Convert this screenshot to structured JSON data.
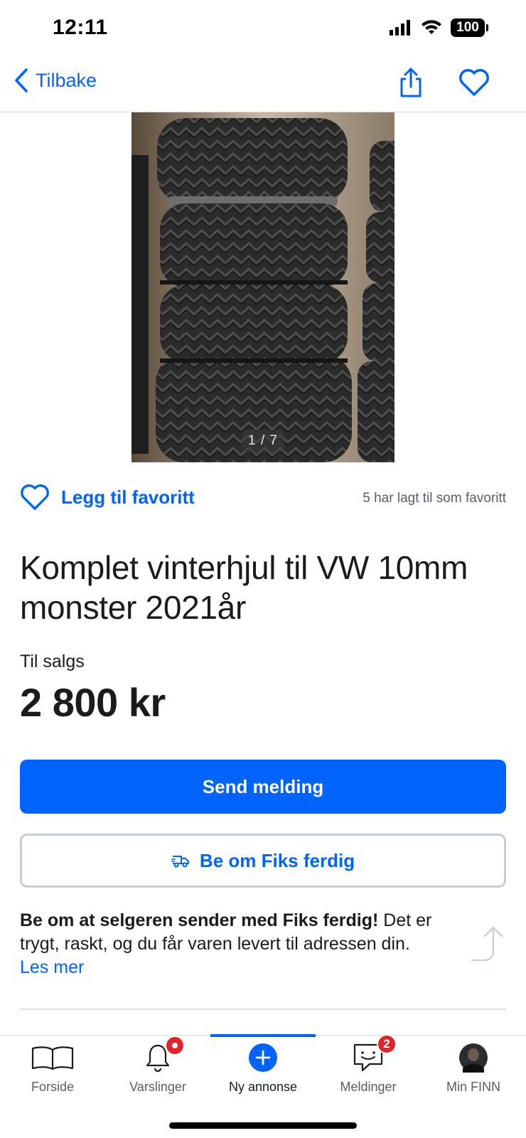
{
  "status_bar": {
    "time": "12:11",
    "battery": "100"
  },
  "nav": {
    "back_label": "Tilbake"
  },
  "gallery": {
    "counter": "1 / 7"
  },
  "favorite": {
    "add_label": "Legg til favoritt",
    "count_text": "5 har lagt til som favoritt"
  },
  "ad": {
    "title": "Komplet vinterhjul til VW 10mm monster 2021år",
    "type": "Til salgs",
    "price": "2 800 kr"
  },
  "actions": {
    "send_label": "Send melding",
    "fiks_label": "Be om Fiks ferdig"
  },
  "fiks_info": {
    "bold": "Be om at selgeren sender med Fiks ferdig!",
    "text": " Det er trygt, raskt, og du får varen levert til adressen din.",
    "read_more": "Les mer"
  },
  "tabs": [
    {
      "label": "Forside",
      "icon": "book-icon"
    },
    {
      "label": "Varslinger",
      "icon": "bell-icon",
      "badge": ""
    },
    {
      "label": "Ny annonse",
      "icon": "plus-circle-icon",
      "active": true
    },
    {
      "label": "Meldinger",
      "icon": "chat-icon",
      "badge": "2"
    },
    {
      "label": "Min FINN",
      "icon": "avatar"
    }
  ],
  "colors": {
    "accent": "#0063fb",
    "badge": "#e0242b",
    "text": "#1b1b1f"
  }
}
